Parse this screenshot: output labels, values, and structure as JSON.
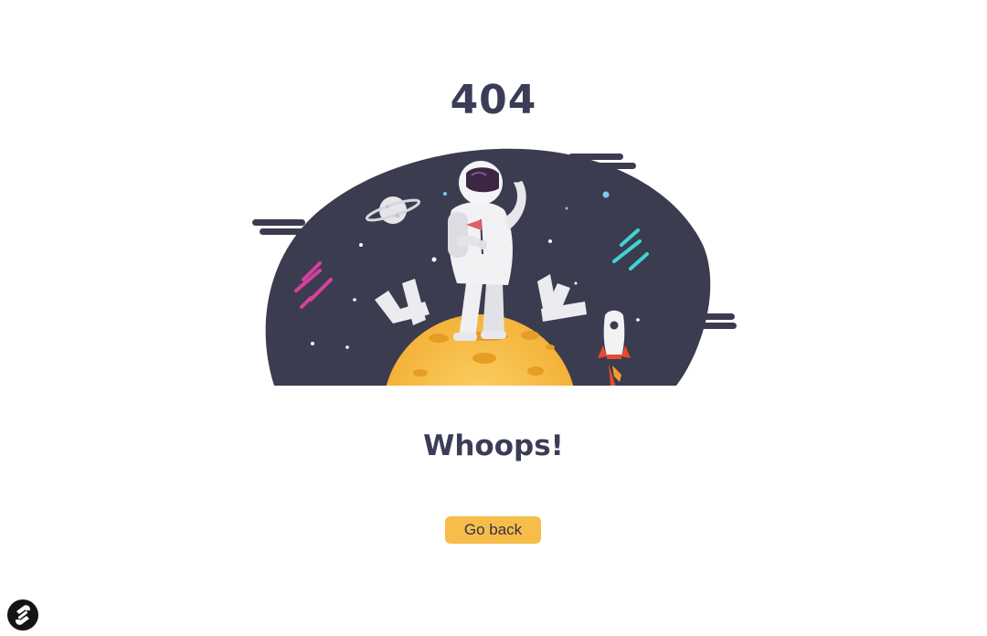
{
  "error": {
    "code": "404"
  },
  "message": {
    "headline": "Whoops!"
  },
  "actions": {
    "go_back_label": "Go back"
  },
  "icons": {
    "illustration": "astronaut-on-moon-illustration",
    "logo": "brand-logo-icon"
  },
  "colors": {
    "text": "#3b3d57",
    "accent": "#f7bd4a",
    "space": "#3c3c50",
    "moon": "#f7bb3f"
  }
}
